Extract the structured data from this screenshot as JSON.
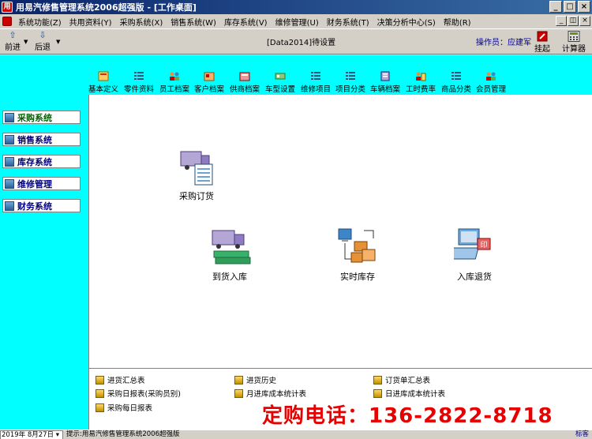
{
  "window": {
    "title": "用易汽修售管理系统2006超强版 - [工作桌面]"
  },
  "menu": [
    "系统功能(Z)",
    "共用资料(Y)",
    "采购系统(X)",
    "销售系统(W)",
    "库存系统(V)",
    "维修管理(U)",
    "财务系统(T)",
    "决策分析中心(S)",
    "帮助(R)"
  ],
  "toolbar": {
    "forward": "前进",
    "back": "后退",
    "doc_title": "[Data2014]待设置",
    "operator": "操作员：应建军",
    "hang": "挂起",
    "calculator": "计算器"
  },
  "quickbar": [
    "基本定义",
    "零件资料",
    "员工档案",
    "客户档案",
    "供商档案",
    "车型设置",
    "维修项目",
    "项目分类",
    "车辆档案",
    "工时费率",
    "商品分类",
    "会员管理"
  ],
  "nav": [
    "采购系统",
    "销售系统",
    "库存系统",
    "维修管理",
    "财务系统"
  ],
  "main": {
    "purchase_order": "采购订货",
    "arrival_stock": "到货入库",
    "realtime_stock": "实时库存",
    "return_goods": "入库退货"
  },
  "reports": [
    "进货汇总表",
    "进货历史",
    "订货单汇总表",
    "采购日报表(采购员别)",
    "月进库成本统计表",
    "日进库成本统计表",
    "采购每日报表"
  ],
  "promo": "定购电话：136-2822-8718",
  "status": {
    "date": "2019年 8月27日",
    "text": "提示:用易汽修售管理系统2006超强版",
    "right": "标客"
  }
}
